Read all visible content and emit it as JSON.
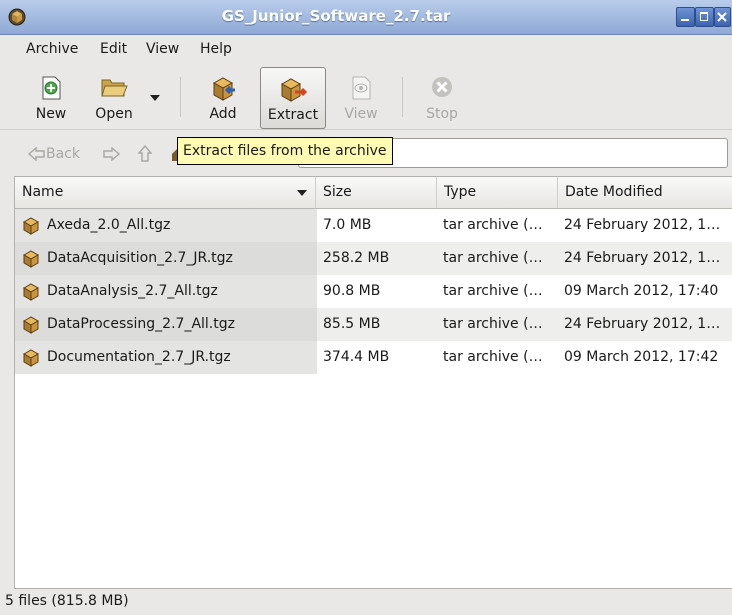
{
  "window": {
    "title": "GS_Junior_Software_2.7.tar"
  },
  "menu": [
    {
      "label": "Archive"
    },
    {
      "label": "Edit"
    },
    {
      "label": "View"
    },
    {
      "label": "Help"
    }
  ],
  "toolbar": {
    "new_label": "New",
    "open_label": "Open",
    "add_label": "Add",
    "extract_label": "Extract",
    "view_label": "View",
    "stop_label": "Stop"
  },
  "location": {
    "back_label": "Back",
    "value": ""
  },
  "tooltip": "Extract files from the archive",
  "table": {
    "columns": [
      "Name",
      "Size",
      "Type",
      "Date Modified"
    ],
    "rows": [
      {
        "name": "Axeda_2.0_All.tgz",
        "size": "7.0 MB",
        "type": "tar archive (…",
        "date": "24 February 2012, 1…"
      },
      {
        "name": "DataAcquisition_2.7_JR.tgz",
        "size": "258.2 MB",
        "type": "tar archive (…",
        "date": "24 February 2012, 1…"
      },
      {
        "name": "DataAnalysis_2.7_All.tgz",
        "size": "90.8 MB",
        "type": "tar archive (…",
        "date": "09 March 2012, 17:40"
      },
      {
        "name": "DataProcessing_2.7_All.tgz",
        "size": "85.5 MB",
        "type": "tar archive (…",
        "date": "24 February 2012, 1…"
      },
      {
        "name": "Documentation_2.7_JR.tgz",
        "size": "374.4 MB",
        "type": "tar archive (…",
        "date": "09 March 2012, 17:42"
      }
    ]
  },
  "status": "5 files (815.8 MB)"
}
